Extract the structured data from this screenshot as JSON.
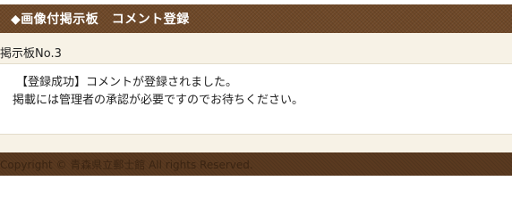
{
  "header": {
    "title": "◆画像付掲示板　コメント登録"
  },
  "board": {
    "name": "掲示板No.3"
  },
  "message": {
    "line1": "【登録成功】コメントが登録されました。",
    "line2": "掲載には管理者の承認が必要ですのでお待ちください。"
  },
  "footer": {
    "copyright": "Copyright © 青森県立郵士館 All rights Reserved."
  },
  "colors": {
    "header_bg": "#6e4828",
    "footer_bg": "#5a3a20",
    "band_bg": "#f7f2e6"
  }
}
